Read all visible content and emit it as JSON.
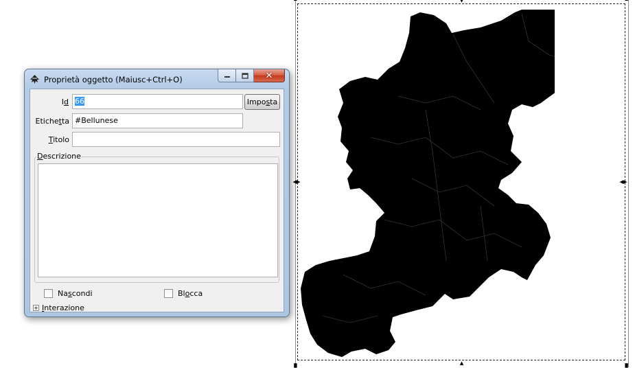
{
  "dialog": {
    "title": "Proprietà oggetto (Maiusc+Ctrl+O)",
    "icon": "inkscape-icon",
    "controls": {
      "minimize": "minimize-icon",
      "maximize": "maximize-icon",
      "close": "close-icon"
    }
  },
  "form": {
    "id_label_pre": "I",
    "id_label_u": "d",
    "id_label_post": "",
    "id_value": "66",
    "set_button_pre": "Impo",
    "set_button_u": "s",
    "set_button_post": "ta",
    "label_label_pre": "Etiche",
    "label_label_u": "t",
    "label_label_post": "ta",
    "label_value": "#Bellunese",
    "title_label_pre": "",
    "title_label_u": "T",
    "title_label_post": "itolo",
    "title_value": "",
    "description_pre": "",
    "description_u": "D",
    "description_post": "escrizione",
    "description_value": "",
    "hide_pre": "Na",
    "hide_u": "s",
    "hide_post": "condi",
    "hide_checked": false,
    "lock_pre": "Bl",
    "lock_u": "o",
    "lock_post": "cca",
    "lock_checked": false,
    "interaction_pre": "",
    "interaction_u": "I",
    "interaction_post": "nterazione",
    "interaction_expander": "+"
  },
  "canvas": {
    "shape_fill": "#000000",
    "handles": [
      "resize-arrow-icon"
    ]
  }
}
